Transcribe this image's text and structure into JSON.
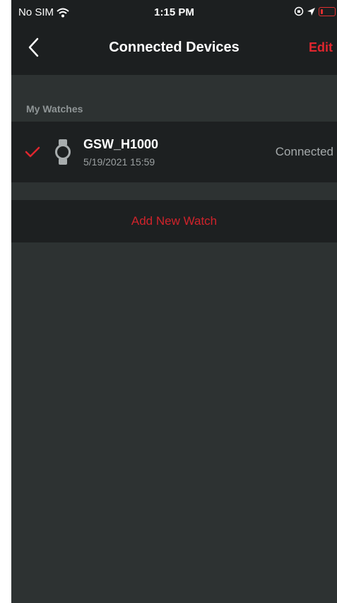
{
  "status_bar": {
    "carrier": "No SIM",
    "time": "1:15 PM",
    "icons": [
      "wifi-icon",
      "orientation-lock-icon",
      "location-arrow-icon",
      "battery-low-icon"
    ]
  },
  "navbar": {
    "back_icon": "chevron-left-icon",
    "title": "Connected Devices",
    "edit_label": "Edit"
  },
  "watches_section": {
    "label": "My Watches",
    "devices": [
      {
        "name": "GSW_H1000",
        "date": "5/19/2021 15:59",
        "status": "Connected",
        "selected": true,
        "icon": "watch-icon"
      }
    ]
  },
  "add_watch": {
    "label": "Add New Watch"
  },
  "colors": {
    "accent": "#e0262e",
    "background": "#2d3232",
    "row_background": "#1d2021",
    "bar_background": "#1c1f20"
  }
}
